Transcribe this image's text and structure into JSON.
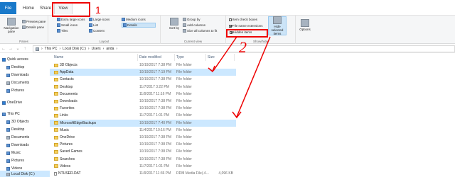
{
  "tabs": {
    "file": "File",
    "home": "Home",
    "share": "Share",
    "view": "View"
  },
  "ribbon": {
    "panes": {
      "nav_pane": "Navigation pane",
      "preview": "Preview pane",
      "details": "Details pane",
      "label": "Panes"
    },
    "layout": {
      "extra_large": "Extra large icons",
      "large": "Large icons",
      "medium": "Medium icons",
      "small": "Small icons",
      "list": "List",
      "details": "Details",
      "tiles": "Tiles",
      "content": "Content",
      "label": "Layout"
    },
    "current_view": {
      "sort": "Sort by",
      "group": "Group by",
      "add_columns": "Add columns",
      "size_all": "Size all columns to fit",
      "label": "Current view"
    },
    "show_hide": {
      "item_check": "Item check boxes",
      "file_ext": "File name extensions",
      "hidden": "Hidden items",
      "hide_selected": "Hide selected items",
      "label": "Show/hide"
    },
    "options": "Options"
  },
  "address": {
    "path": [
      "This PC",
      "Local Disk (C:)",
      "Users",
      "anda"
    ]
  },
  "sidebar": {
    "items": [
      "Quick access",
      "Desktop",
      "Downloads",
      "Documents",
      "Pictures",
      "OneDrive",
      "This PC",
      "3D Objects",
      "Desktop",
      "Documents",
      "Downloads",
      "Music",
      "Pictures",
      "Videos",
      "Local Disk (C:)"
    ]
  },
  "columns": {
    "name": "Name",
    "date": "Date modified",
    "type": "Type",
    "size": "Size"
  },
  "files": [
    {
      "name": "3D Objects",
      "date": "10/19/2017 7:38 PM",
      "type": "File folder",
      "size": ""
    },
    {
      "name": "AppData",
      "date": "10/19/2017 7:19 PM",
      "type": "File folder",
      "size": ""
    },
    {
      "name": "Contacts",
      "date": "10/19/2017 7:38 PM",
      "type": "File folder",
      "size": ""
    },
    {
      "name": "Desktop",
      "date": "11/7/2017 3:22 PM",
      "type": "File folder",
      "size": ""
    },
    {
      "name": "Documents",
      "date": "11/9/2017 11:16 PM",
      "type": "File folder",
      "size": ""
    },
    {
      "name": "Downloads",
      "date": "10/19/2017 7:38 PM",
      "type": "File folder",
      "size": ""
    },
    {
      "name": "Favorites",
      "date": "10/19/2017 7:38 PM",
      "type": "File folder",
      "size": ""
    },
    {
      "name": "Links",
      "date": "11/7/2017 1:01 PM",
      "type": "File folder",
      "size": ""
    },
    {
      "name": "MicrosoftEdgeBackups",
      "date": "10/19/2017 7:40 PM",
      "type": "File folder",
      "size": ""
    },
    {
      "name": "Music",
      "date": "11/4/2017 10:16 PM",
      "type": "File folder",
      "size": ""
    },
    {
      "name": "OneDrive",
      "date": "10/19/2017 7:38 PM",
      "type": "File folder",
      "size": ""
    },
    {
      "name": "Pictures",
      "date": "10/19/2017 7:38 PM",
      "type": "File folder",
      "size": ""
    },
    {
      "name": "Saved Games",
      "date": "10/19/2017 7:38 PM",
      "type": "File folder",
      "size": ""
    },
    {
      "name": "Searches",
      "date": "10/19/2017 7:38 PM",
      "type": "File folder",
      "size": ""
    },
    {
      "name": "Videos",
      "date": "11/7/2017 1:01 PM",
      "type": "File folder",
      "size": ""
    },
    {
      "name": "NTUSER.DAT",
      "date": "11/9/2017 11:36 PM",
      "type": "DDM Media File(.4...",
      "size": "4,096 KB"
    }
  ],
  "annotations": {
    "one": "1",
    "two": "2"
  },
  "colors": {
    "annotation": "#e00000",
    "file_tab": "#1979ca",
    "selection": "#cce8ff"
  }
}
